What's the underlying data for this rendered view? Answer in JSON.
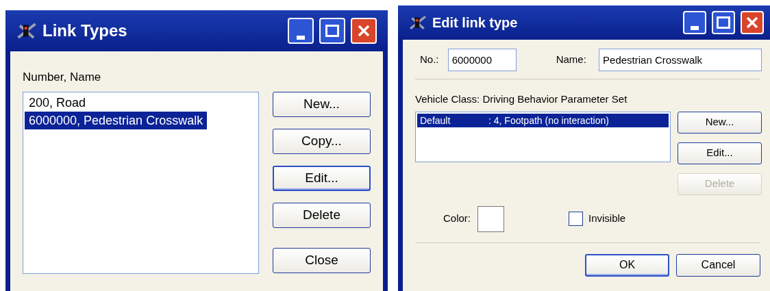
{
  "link_types_window": {
    "title": "Link Types",
    "list_label": "Number, Name",
    "items": [
      {
        "label": "200, Road",
        "selected": false
      },
      {
        "label": "6000000, Pedestrian Crosswalk",
        "selected": true
      }
    ],
    "buttons": [
      {
        "label": "New...",
        "focused": false,
        "disabled": false
      },
      {
        "label": "Copy...",
        "focused": false,
        "disabled": false
      },
      {
        "label": "Edit...",
        "focused": true,
        "disabled": false
      },
      {
        "label": "Delete",
        "focused": false,
        "disabled": false
      },
      {
        "label": "Close",
        "focused": false,
        "disabled": false
      }
    ]
  },
  "edit_window": {
    "title": "Edit link type",
    "number_label": "No.:",
    "number_value": "6000000",
    "name_label": "Name:",
    "name_value": "Pedestrian Crosswalk",
    "list_label": "Vehicle Class: Driving Behavior Parameter Set",
    "rows": [
      {
        "vehicle_class": "Default",
        "parameter_set": ": 4, Footpath (no interaction)",
        "selected": true
      }
    ],
    "list_buttons": [
      {
        "label": "New...",
        "focused": false,
        "disabled": false
      },
      {
        "label": "Edit...",
        "focused": false,
        "disabled": false
      },
      {
        "label": "Delete",
        "focused": false,
        "disabled": true
      }
    ],
    "color_label": "Color:",
    "color": "#ffffff",
    "invisible": {
      "label": "Invisible",
      "checked": false
    },
    "buttons": [
      {
        "label": "OK",
        "focused": true,
        "disabled": false
      },
      {
        "label": "Cancel",
        "focused": false,
        "disabled": false
      }
    ]
  }
}
